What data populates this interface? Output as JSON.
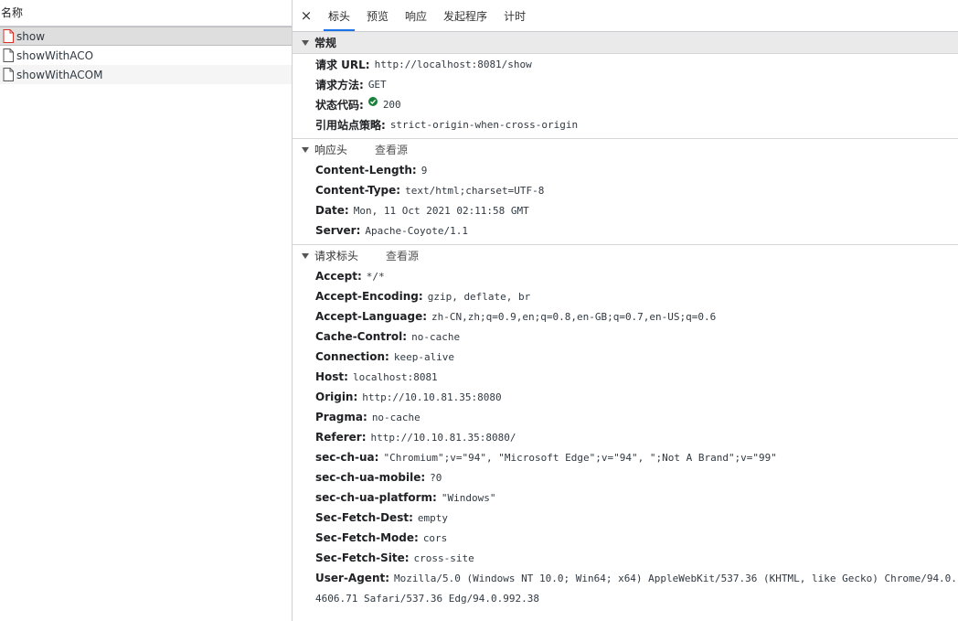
{
  "left": {
    "header": "名称",
    "requests": [
      {
        "name": "show"
      },
      {
        "name": "showWithACO"
      },
      {
        "name": "showWithACOM"
      }
    ]
  },
  "tabs": {
    "close": "×",
    "items": [
      "标头",
      "预览",
      "响应",
      "发起程序",
      "计时"
    ]
  },
  "general": {
    "title": "常规",
    "rows": [
      {
        "key": "请求 URL:",
        "value": "http://localhost:8081/show"
      },
      {
        "key": "请求方法:",
        "value": "GET"
      },
      {
        "key": "状态代码:",
        "value": "200"
      },
      {
        "key": "引用站点策略:",
        "value": "strict-origin-when-cross-origin"
      }
    ]
  },
  "response_headers": {
    "title": "响应头",
    "view_source": "查看源",
    "rows": [
      {
        "key": "Content-Length:",
        "value": "9"
      },
      {
        "key": "Content-Type:",
        "value": "text/html;charset=UTF-8"
      },
      {
        "key": "Date:",
        "value": "Mon, 11 Oct 2021 02:11:58 GMT"
      },
      {
        "key": "Server:",
        "value": "Apache-Coyote/1.1"
      }
    ]
  },
  "request_headers": {
    "title": "请求标头",
    "view_source": "查看源",
    "rows": [
      {
        "key": "Accept:",
        "value": "*/*"
      },
      {
        "key": "Accept-Encoding:",
        "value": "gzip, deflate, br"
      },
      {
        "key": "Accept-Language:",
        "value": "zh-CN,zh;q=0.9,en;q=0.8,en-GB;q=0.7,en-US;q=0.6"
      },
      {
        "key": "Cache-Control:",
        "value": "no-cache"
      },
      {
        "key": "Connection:",
        "value": "keep-alive"
      },
      {
        "key": "Host:",
        "value": "localhost:8081"
      },
      {
        "key": "Origin:",
        "value": "http://10.10.81.35:8080"
      },
      {
        "key": "Pragma:",
        "value": "no-cache"
      },
      {
        "key": "Referer:",
        "value": "http://10.10.81.35:8080/"
      },
      {
        "key": "sec-ch-ua:",
        "value": "\"Chromium\";v=\"94\", \"Microsoft Edge\";v=\"94\", \";Not A Brand\";v=\"99\""
      },
      {
        "key": "sec-ch-ua-mobile:",
        "value": "?0"
      },
      {
        "key": "sec-ch-ua-platform:",
        "value": "\"Windows\""
      },
      {
        "key": "Sec-Fetch-Dest:",
        "value": "empty"
      },
      {
        "key": "Sec-Fetch-Mode:",
        "value": "cors"
      },
      {
        "key": "Sec-Fetch-Site:",
        "value": "cross-site"
      },
      {
        "key": "User-Agent:",
        "value": "Mozilla/5.0 (Windows NT 10.0; Win64; x64) AppleWebKit/537.36 (KHTML, like Gecko) Chrome/94.0.4606.71 Safari/537.36 Edg/94.0.992.38"
      }
    ]
  },
  "colors": {
    "accent": "#1a73e8",
    "status_ok": "#188038",
    "selected_file_icon": "#d93025"
  }
}
